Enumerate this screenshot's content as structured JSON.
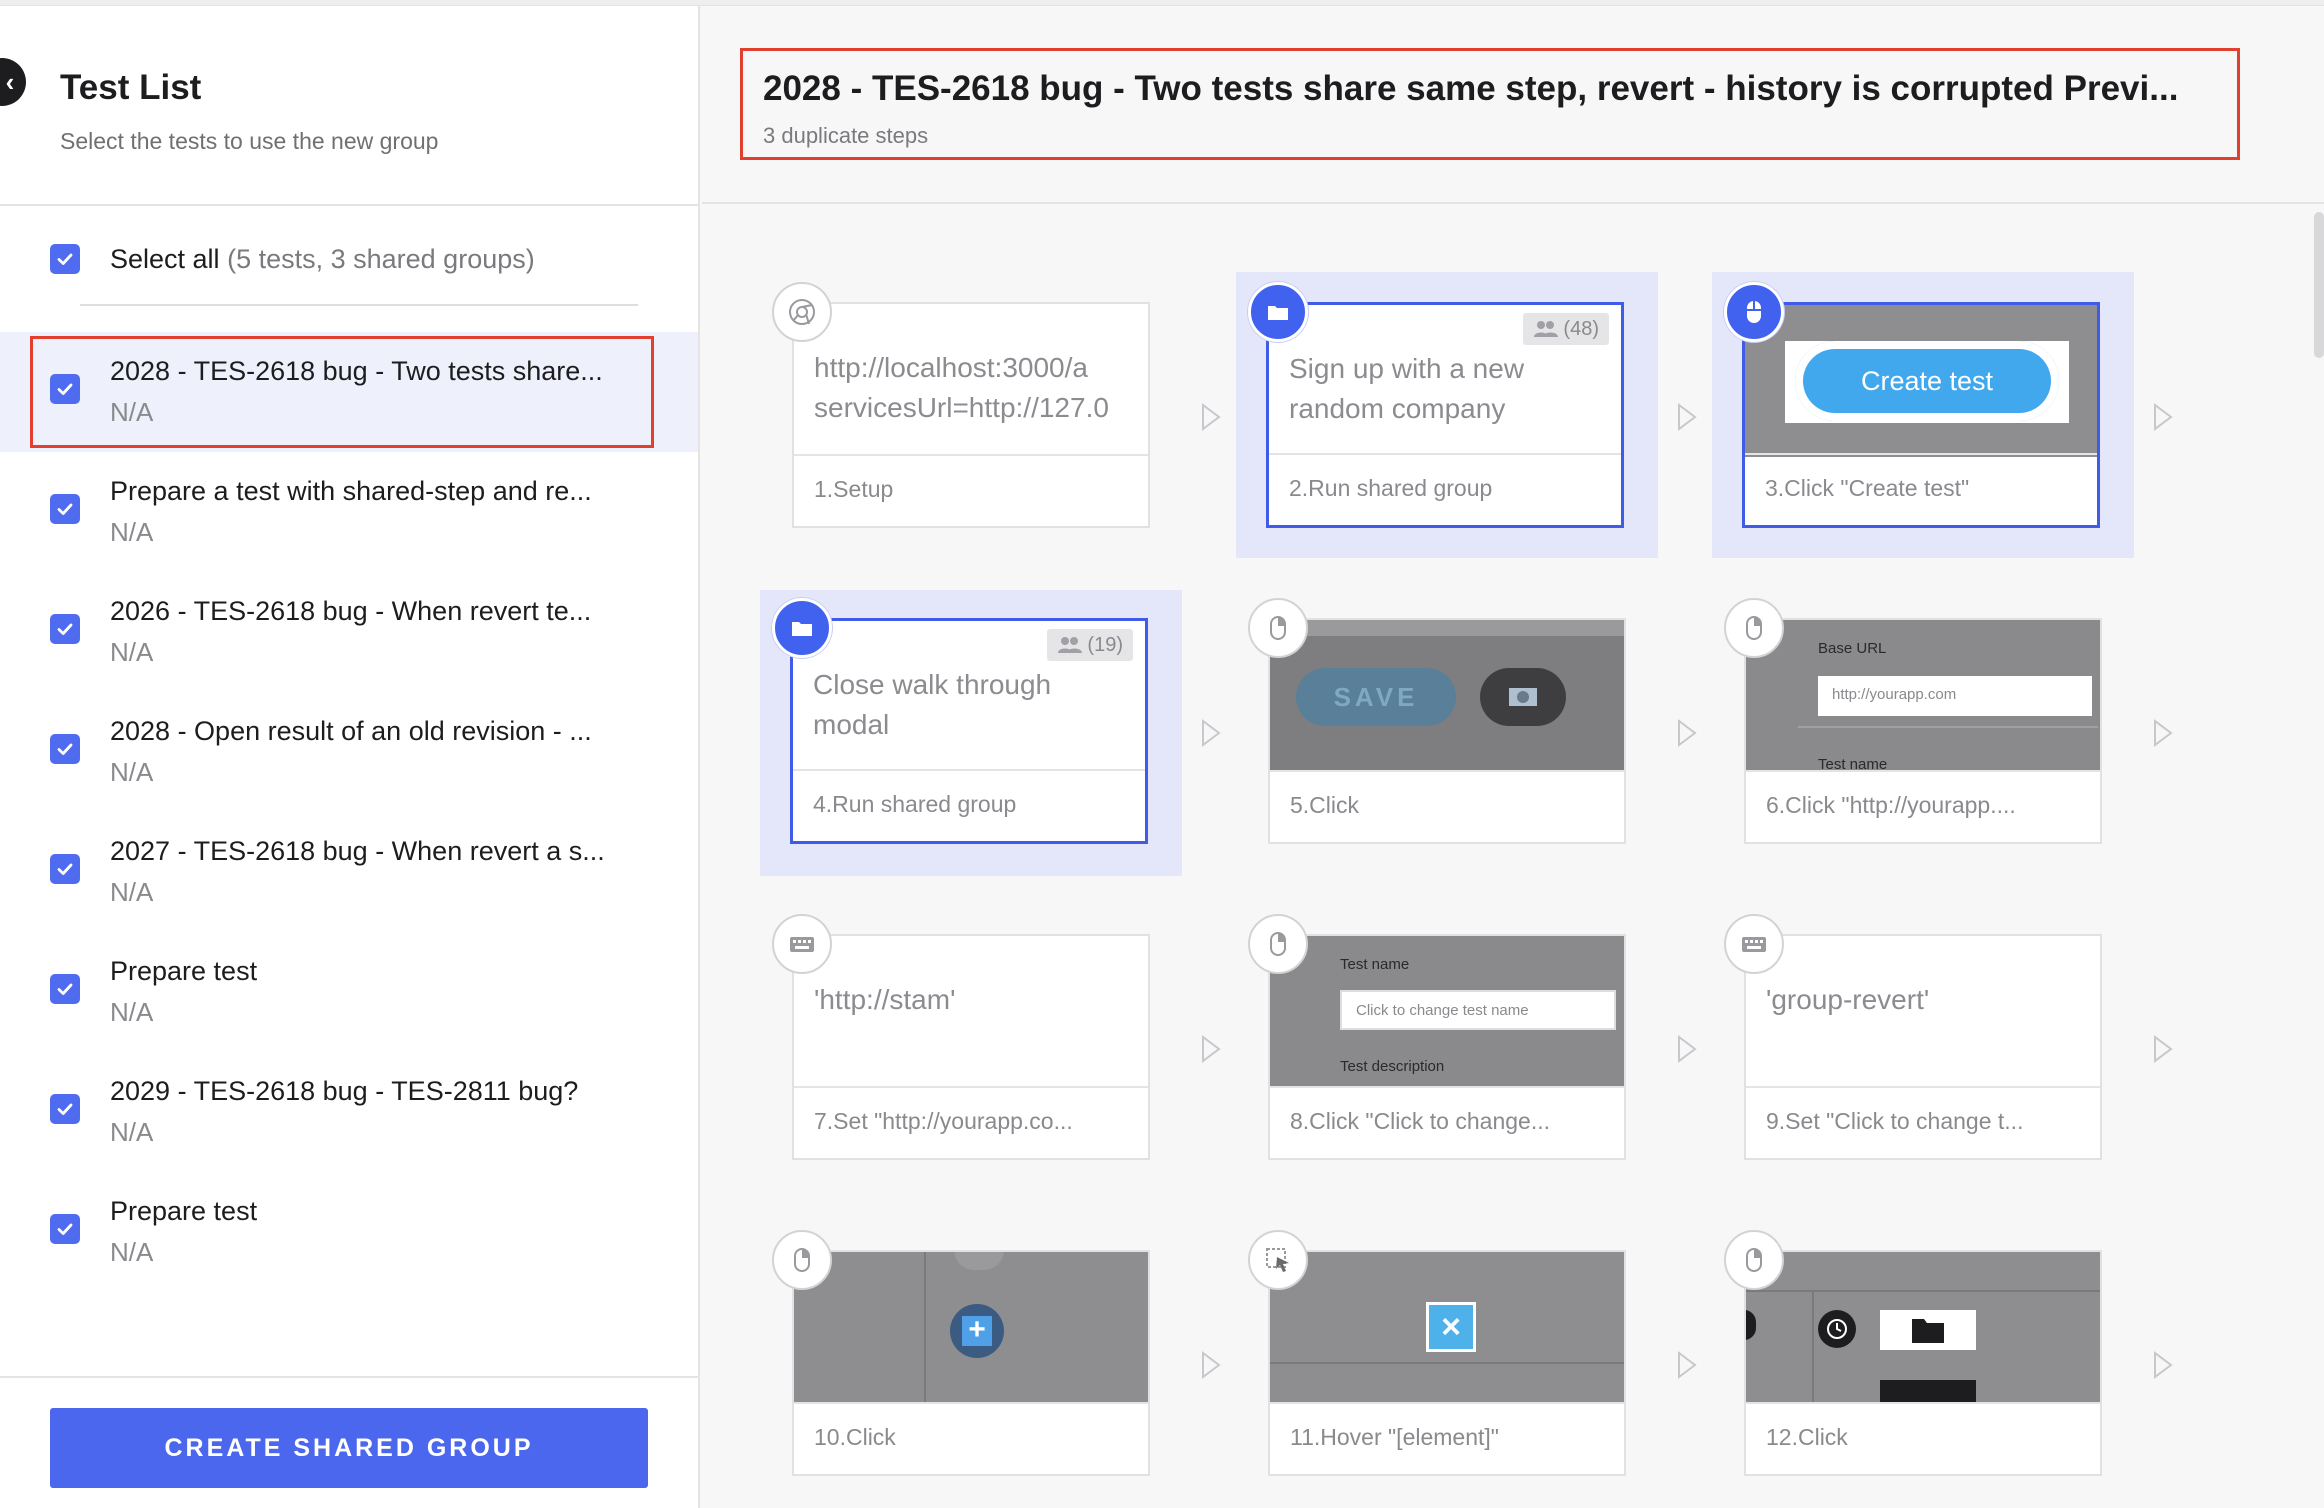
{
  "sidebar": {
    "title": "Test List",
    "subtitle": "Select the tests to use the new group",
    "select_all": {
      "label": "Select all",
      "detail": "(5 tests, 3 shared groups)"
    },
    "tests": [
      {
        "name": "2028 - TES-2618 bug - Two tests share...",
        "status": "N/A",
        "selected": true
      },
      {
        "name": "Prepare a test with shared-step and re...",
        "status": "N/A"
      },
      {
        "name": "2026 - TES-2618 bug - When revert te...",
        "status": "N/A"
      },
      {
        "name": "2028 - Open result of an old revision - ...",
        "status": "N/A"
      },
      {
        "name": "2027 - TES-2618 bug - When revert a s...",
        "status": "N/A"
      },
      {
        "name": "Prepare test",
        "status": "N/A"
      },
      {
        "name": "2029 - TES-2618 bug - TES-2811 bug?",
        "status": "N/A"
      },
      {
        "name": "Prepare test",
        "status": "N/A"
      }
    ],
    "create_button": "CREATE SHARED GROUP"
  },
  "main": {
    "title": "2028 - TES-2618 bug - Two tests share same step, revert - history is corrupted Previ...",
    "subtitle": "3 duplicate steps",
    "steps": [
      {
        "label": "1.Setup",
        "content": "http://localhost:3000/a\nservicesUrl=http://127.0",
        "icon": "chrome-icon"
      },
      {
        "label": "2.Run shared group",
        "content": "Sign up with a new random company",
        "badge": "(48)",
        "icon": "folder-icon",
        "shared": true
      },
      {
        "label": "3.Click \"Create test\"",
        "content": "Create test",
        "icon": "mouse-icon",
        "shared": true
      },
      {
        "label": "4.Run shared group",
        "content": "Close walk through modal",
        "badge": "(19)",
        "icon": "folder-icon",
        "shared": true
      },
      {
        "label": "5.Click",
        "content": "SAVE",
        "icon": "mouse-icon"
      },
      {
        "label": "6.Click \"http://yourapp....",
        "content_label": "Base URL",
        "content_value": "http://yourapp.com",
        "content_label2": "Test name",
        "icon": "mouse-icon"
      },
      {
        "label": "7.Set \"http://yourapp.co...",
        "content": "'http://stam'",
        "icon": "keyboard-icon"
      },
      {
        "label": "8.Click \"Click to change...",
        "content_label": "Test name",
        "content_value": "Click to change test name",
        "content_label2": "Test description",
        "icon": "mouse-icon"
      },
      {
        "label": "9.Set \"Click to change t...",
        "content": "'group-revert'",
        "icon": "keyboard-icon"
      },
      {
        "label": "10.Click",
        "icon": "mouse-icon"
      },
      {
        "label": "11.Hover \"[element]\"",
        "icon": "hover-icon"
      },
      {
        "label": "12.Click",
        "icon": "mouse-icon"
      }
    ]
  },
  "colors": {
    "accent": "#4b67ee",
    "highlight": "#e2402e",
    "shared_bg": "#e4e7fa"
  }
}
